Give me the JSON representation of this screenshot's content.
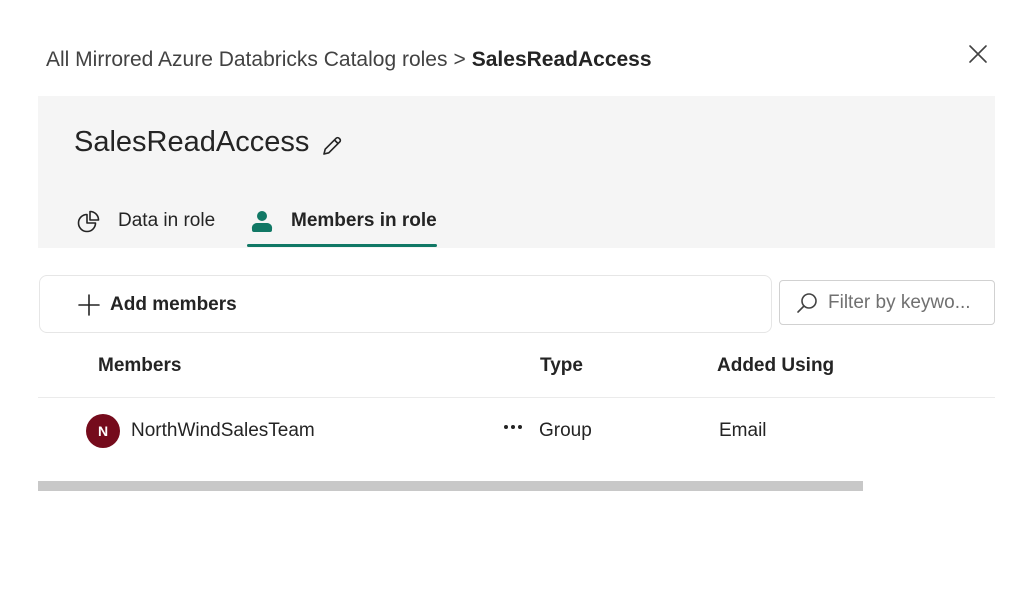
{
  "breadcrumb": {
    "parent": "All Mirrored Azure Databricks Catalog roles",
    "separator": ">",
    "current": "SalesReadAccess"
  },
  "role": {
    "title": "SalesReadAccess"
  },
  "tabs": [
    {
      "label": "Data in role",
      "icon": "pie-chart-icon",
      "selected": false
    },
    {
      "label": "Members in role",
      "icon": "person-icon",
      "selected": true
    }
  ],
  "toolbar": {
    "add_label": "Add members"
  },
  "filter": {
    "placeholder": "Filter by keywo...",
    "value": ""
  },
  "table": {
    "columns": [
      "Members",
      "Type",
      "Added Using"
    ],
    "rows": [
      {
        "initial": "N",
        "name": "NorthWindSalesTeam",
        "type": "Group",
        "added_using": "Email"
      }
    ]
  },
  "colors": {
    "accent": "#117865",
    "avatar": "#750b1c",
    "panel": "#f5f5f5"
  }
}
